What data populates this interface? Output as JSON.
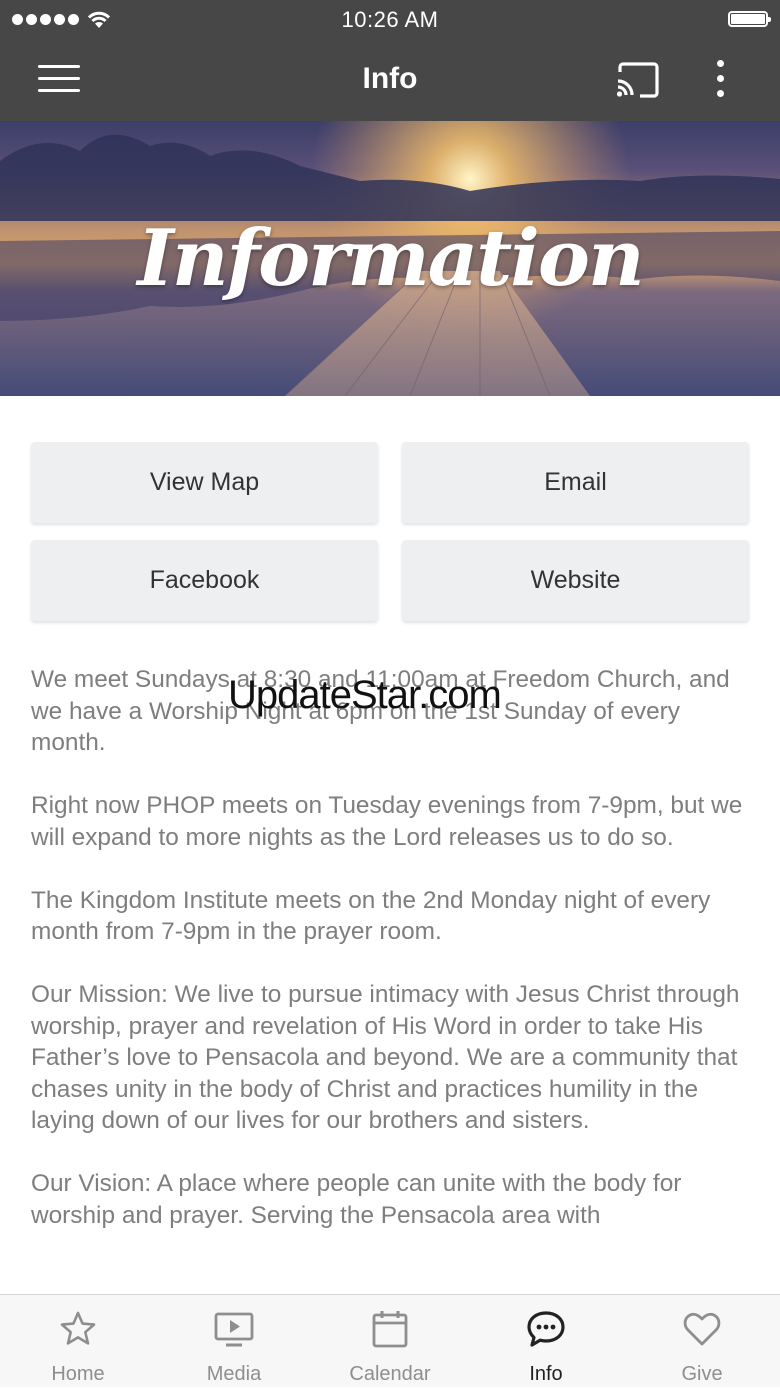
{
  "status_bar": {
    "time": "10:26 AM"
  },
  "navbar": {
    "title": "Info",
    "icons": [
      "menu-icon",
      "cast-icon",
      "more-vertical-icon"
    ]
  },
  "banner": {
    "title": "Information"
  },
  "buttons": {
    "view_map": "View Map",
    "email": "Email",
    "facebook": "Facebook",
    "website": "Website"
  },
  "content": {
    "paragraphs": [
      "We meet Sundays at 8:30 and 11:00am at Freedom Church, and we have a Worship Night at 6pm on the 1st Sunday of every month.",
      "Right now PHOP meets on Tuesday evenings from 7-9pm, but we will expand to more nights as the Lord releases us to do so.",
      "The Kingdom Institute meets on the 2nd Monday night of every month from 7-9pm in the prayer room.",
      "Our Mission: We live to pursue intimacy with Jesus Christ through worship, prayer and revelation of His Word in order to take His Father’s love to Pensacola and beyond. We are a community that chases unity in the body of Christ and practices humility in the laying down of our lives for our brothers and sisters.",
      "Our Vision: A place where people can unite with the body for worship and prayer. Serving the Pensacola area with"
    ]
  },
  "watermark": "UpdateStar.com",
  "tabbar": {
    "tabs": [
      {
        "label": "Home",
        "icon": "star-icon"
      },
      {
        "label": "Media",
        "icon": "play-screen-icon"
      },
      {
        "label": "Calendar",
        "icon": "calendar-icon"
      },
      {
        "label": "Info",
        "icon": "chat-bubble-icon"
      },
      {
        "label": "Give",
        "icon": "heart-icon"
      }
    ],
    "active": "Info"
  }
}
